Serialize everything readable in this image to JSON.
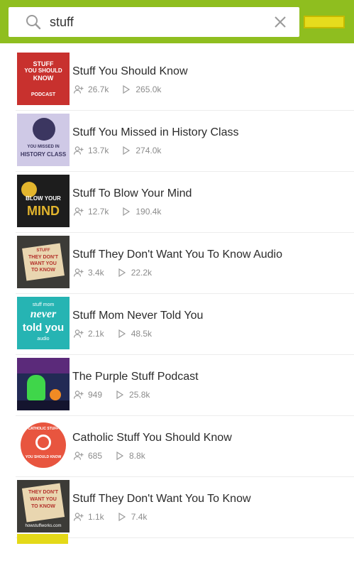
{
  "search": {
    "query": "stuff",
    "cancel_label": ""
  },
  "results": [
    {
      "title": "Stuff You Should Know",
      "subscribers": "26.7k",
      "episodes": "265.0k",
      "art": {
        "bg": "#c8312e",
        "line1": "STUFF",
        "line2": "YOU SHOULD",
        "line3": "KNOW",
        "line4": "PODCAST"
      }
    },
    {
      "title": "Stuff You Missed in History Class",
      "subscribers": "13.7k",
      "episodes": "274.0k",
      "art": {
        "bg": "#cfc9e6",
        "line1": "YOU MISSED IN",
        "line2": "HISTORY CLASS"
      }
    },
    {
      "title": "Stuff To Blow Your Mind",
      "subscribers": "12.7k",
      "episodes": "190.4k",
      "art": {
        "bg": "#1d1d1d",
        "line1": "BLOW YOUR",
        "line2": "MIND"
      }
    },
    {
      "title": "Stuff They Don't Want You To Know Audio",
      "subscribers": "3.4k",
      "episodes": "22.2k",
      "art": {
        "bg": "#3c3b37",
        "line1": "STUFF",
        "line2": "THEY DON'T",
        "line3": "WANT YOU",
        "line4": "TO KNOW"
      }
    },
    {
      "title": "Stuff Mom Never Told You",
      "subscribers": "2.1k",
      "episodes": "48.5k",
      "art": {
        "bg": "#26b4b3",
        "line1": "stuff mom",
        "line2": "never",
        "line3": "told you",
        "line4": "audio"
      }
    },
    {
      "title": "The Purple Stuff Podcast",
      "subscribers": "949",
      "episodes": "25.8k",
      "art": {
        "bg": "#222a55"
      }
    },
    {
      "title": "Catholic Stuff You Should Know",
      "subscribers": "685",
      "episodes": "8.8k",
      "art": {
        "bg": "#ffffff",
        "ring": "#e8553f",
        "line1": "CATHOLIC STUFF",
        "line2": "YOU SHOULD KNOW"
      }
    },
    {
      "title": "Stuff They Don't Want You To Know",
      "subscribers": "1.1k",
      "episodes": "7.4k",
      "art": {
        "bg": "#3c3b37",
        "line1": "THEY DON'T",
        "line2": "WANT YOU",
        "line3": "TO KNOW",
        "line4": "howstuffworks.com"
      }
    }
  ],
  "colors": {
    "header": "#8fbe1f",
    "cancel": "#e6dc1d",
    "meta": "#8c8c8c"
  }
}
